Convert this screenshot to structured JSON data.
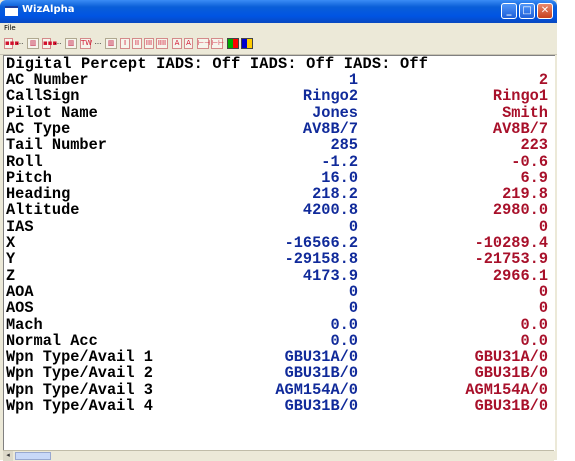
{
  "window": {
    "title": "WizAlpha"
  },
  "menu": {
    "file": "File"
  },
  "toolbar": [
    {
      "label": "▪▪▪",
      "style": "red"
    },
    {
      "label": "...",
      "style": "dots"
    },
    {
      "label": "▥",
      "style": ""
    },
    {
      "label": "▪▪▪",
      "style": "red"
    },
    {
      "label": "...",
      "style": "dots"
    },
    {
      "label": "▥",
      "style": ""
    },
    {
      "label": "TW",
      "style": "red"
    },
    {
      "label": "...",
      "style": "dots"
    },
    {
      "label": "▥",
      "style": ""
    },
    {
      "label": "I",
      "style": "red"
    },
    {
      "label": "II",
      "style": "red"
    },
    {
      "label": "III",
      "style": "red"
    },
    {
      "label": "IIII",
      "style": "red"
    },
    {
      "label": "A",
      "style": "red"
    },
    {
      "label": "A",
      "style": "red"
    },
    {
      "label": "⊢⊣",
      "style": "red"
    },
    {
      "label": "⊢⊢",
      "style": "red"
    },
    {
      "label": "",
      "style": "col"
    },
    {
      "label": "",
      "style": "col"
    }
  ],
  "header": {
    "label": "Digital Percept",
    "iads1": "IADS: Off",
    "iads2": "IADS: Off",
    "iads3": "IADS: Off"
  },
  "rows": [
    {
      "label": "AC Number",
      "v1": "1",
      "v2": "2"
    },
    {
      "label": "CallSign",
      "v1": "Ringo2",
      "v2": "Ringo1"
    },
    {
      "label": "Pilot Name",
      "v1": "Jones",
      "v2": "Smith"
    },
    {
      "label": "AC Type",
      "v1": "AV8B/7",
      "v2": "AV8B/7"
    },
    {
      "label": "Tail Number",
      "v1": "285",
      "v2": "223"
    },
    {
      "label": "Roll",
      "v1": "-1.2",
      "v2": "-0.6"
    },
    {
      "label": "Pitch",
      "v1": "16.0",
      "v2": "6.9"
    },
    {
      "label": "Heading",
      "v1": "218.2",
      "v2": "219.8"
    },
    {
      "label": "Altitude",
      "v1": "4200.8",
      "v2": "2980.0"
    },
    {
      "label": "IAS",
      "v1": "0",
      "v2": "0"
    },
    {
      "label": "X",
      "v1": "-16566.2",
      "v2": "-10289.4"
    },
    {
      "label": "Y",
      "v1": "-29158.8",
      "v2": "-21753.9"
    },
    {
      "label": "Z",
      "v1": "4173.9",
      "v2": "2966.1"
    },
    {
      "label": "AOA",
      "v1": "0",
      "v2": "0"
    },
    {
      "label": "AOS",
      "v1": "0",
      "v2": "0"
    },
    {
      "label": "Mach",
      "v1": "0.0",
      "v2": "0.0"
    },
    {
      "label": "Normal Acc",
      "v1": "0.0",
      "v2": "0.0"
    },
    {
      "label": "Wpn Type/Avail 1",
      "v1": "GBU31A/0",
      "v2": "GBU31A/0"
    },
    {
      "label": "Wpn Type/Avail 2",
      "v1": "GBU31B/0",
      "v2": "GBU31B/0"
    },
    {
      "label": "Wpn Type/Avail 3",
      "v1": "AGM154A/0",
      "v2": "AGM154A/0"
    },
    {
      "label": "Wpn Type/Avail 4",
      "v1": "GBU31B/0",
      "v2": "GBU31B/0"
    }
  ],
  "colors": {
    "col1": "#102a9a",
    "col2": "#a8102a",
    "titlebar": "#0054e3"
  }
}
